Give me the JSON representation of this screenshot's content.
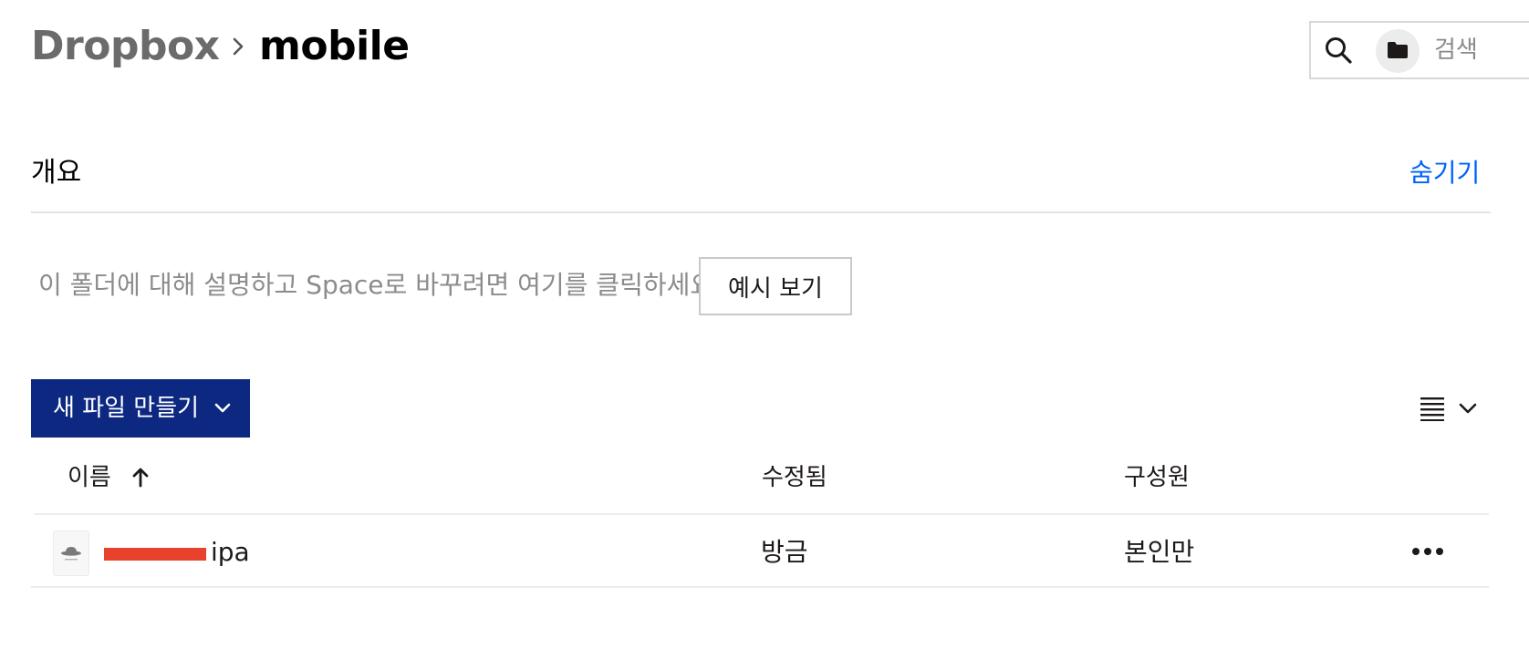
{
  "breadcrumb": {
    "root": "Dropbox",
    "separator_icon": "chevron-right-icon",
    "current": "mobile"
  },
  "search": {
    "placeholder": "검색",
    "search_icon": "search-icon",
    "scope_icon": "folder-icon"
  },
  "overview": {
    "title": "개요",
    "hide_label": "숨기기",
    "description": "이 폴더에 대해 설명하고 Space로 바꾸려면 여기를 클릭하세요.",
    "example_button": "예시 보기"
  },
  "toolbar": {
    "create_label": "새 파일 만들기",
    "create_icon": "chevron-down-icon",
    "view_icon": "list-view-icon",
    "view_chevron": "chevron-down-icon"
  },
  "table": {
    "columns": {
      "name": "이름",
      "name_sort_icon": "arrow-up-icon",
      "modified": "수정됨",
      "members": "구성원"
    },
    "rows": [
      {
        "name": "ipa",
        "name_redacted_prefix": true,
        "icon": "ipa-file-icon",
        "modified": "방금",
        "members": "본인만",
        "actions_icon": "more-horizontal-icon"
      }
    ]
  },
  "colors": {
    "accent": "#0061fe",
    "primary_button": "#0d2881",
    "redaction": "#e8412c"
  }
}
